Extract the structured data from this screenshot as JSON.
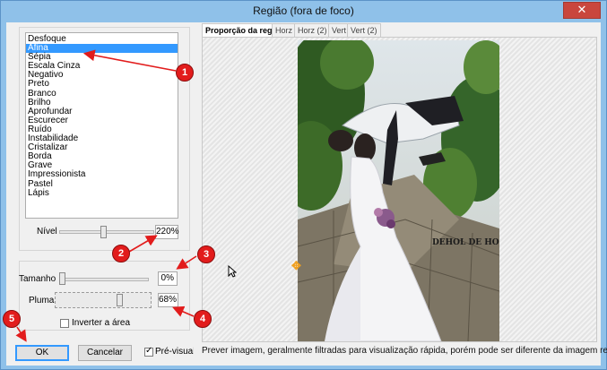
{
  "window": {
    "title": "Região (fora de foco)",
    "close_glyph": "✕"
  },
  "filters": {
    "items": [
      "Desfoque",
      "Afina",
      "Sépia",
      "Escala Cinza",
      "Negativo",
      "Preto",
      "Branco",
      "Brilho",
      "Aprofundar",
      "Escurecer",
      "Ruído",
      "Instabilidade",
      "Cristalizar",
      "Borda",
      "Grave",
      "Impressionista",
      "Pastel",
      "Lápis"
    ],
    "selected_index": 1
  },
  "level": {
    "label": "Nível",
    "value": "220%",
    "slider_fraction": 0.46
  },
  "size": {
    "label": "Tamanho",
    "value": "0%",
    "slider_fraction": 0.0
  },
  "feather": {
    "label": "Pluma",
    "value": "68%",
    "slider_fraction": 0.68
  },
  "invert": {
    "label": "Inverter a área",
    "checked": false
  },
  "buttons": {
    "ok": "OK",
    "cancel": "Cancelar"
  },
  "preview_checkbox": {
    "label": "Pré-visualiz",
    "checked": true
  },
  "tabs": [
    {
      "label": "Proporção da região",
      "active": true
    },
    {
      "label": "Horz",
      "active": false
    },
    {
      "label": "Horz (2)",
      "active": false
    },
    {
      "label": "Vert",
      "active": false
    },
    {
      "label": "Vert (2)",
      "active": false
    }
  ],
  "hint": "Prever imagem, geralmente filtradas para visualização rápida, porém pode ser diferente da imagem real.",
  "photo": {
    "watermark": "DEHOL DE HOM"
  },
  "annotations": [
    "1",
    "2",
    "3",
    "4",
    "5"
  ],
  "colors": {
    "accent": "#3399ff",
    "annotation": "#e21c1c",
    "titlebar": "#8fc1e9"
  },
  "icons": {
    "cursor": "mouse-pointer-icon",
    "move": "move-cross-icon",
    "close": "close-icon"
  }
}
